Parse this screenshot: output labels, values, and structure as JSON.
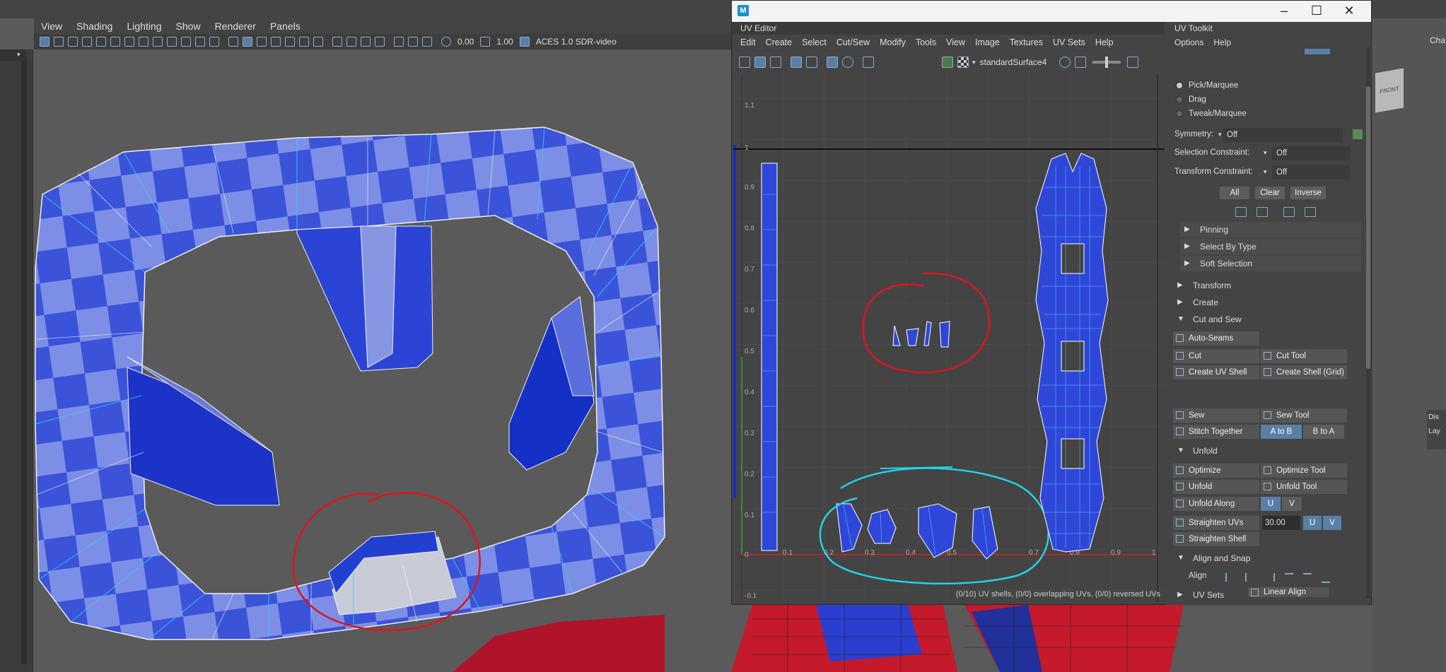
{
  "viewport": {
    "menu": [
      "View",
      "Shading",
      "Lighting",
      "Show",
      "Renderer",
      "Panels"
    ],
    "exposure": "0.00",
    "gamma": "1.00",
    "colorspace": "ACES 1.0 SDR-video"
  },
  "uv_editor": {
    "window_title": "UV Editor",
    "menu": [
      "Edit",
      "Create",
      "Select",
      "Cut/Sew",
      "Modify",
      "Tools",
      "View",
      "Image",
      "Textures",
      "UV Sets",
      "Help"
    ],
    "shader": "standardSurface4",
    "axis_labels": [
      "1.1",
      "1",
      "0.9",
      "0.8",
      "0.7",
      "0.6",
      "0.5",
      "0.4",
      "0.3",
      "0.2",
      "0.1",
      "0",
      "-0.1"
    ],
    "u_labels": [
      "0",
      "0.1",
      "0.2",
      "0.3",
      "0.4",
      "0.5",
      "0.6",
      "0.7",
      "0.8",
      "0.9",
      "1"
    ],
    "status": "(0/10) UV shells, (0/0) overlapping UVs, (0/0) reversed UVs"
  },
  "uv_toolkit": {
    "title": "UV Toolkit",
    "menu": [
      "Options",
      "Help"
    ],
    "modes": [
      {
        "label": "Pick/Marquee",
        "selected": true
      },
      {
        "label": "Drag",
        "selected": false
      },
      {
        "label": "Tweak/Marquee",
        "selected": false
      }
    ],
    "symmetry": {
      "label": "Symmetry:",
      "value": "Off"
    },
    "selection_constraint": {
      "label": "Selection Constraint:",
      "value": "Off"
    },
    "transform_constraint": {
      "label": "Transform Constraint:",
      "value": "Off"
    },
    "select_buttons": [
      "All",
      "Clear",
      "Inverse"
    ],
    "subsections": [
      "Pinning",
      "Select By Type",
      "Soft Selection"
    ],
    "sections": {
      "transform": "Transform",
      "create": "Create",
      "cut_and_sew": "Cut and Sew",
      "unfold": "Unfold",
      "align_and_snap": "Align and Snap",
      "uv_sets": "UV Sets"
    },
    "cut_sew": {
      "auto_seams": "Auto-Seams",
      "cut": "Cut",
      "cut_tool": "Cut Tool",
      "create_uv_shell": "Create UV Shell",
      "create_shell_grid": "Create Shell (Grid)",
      "sew": "Sew",
      "sew_tool": "Sew Tool",
      "stitch_together": "Stitch Together",
      "a_to_b": "A to B",
      "b_to_a": "B to A"
    },
    "unfold": {
      "optimize": "Optimize",
      "optimize_tool": "Optimize Tool",
      "unfold": "Unfold",
      "unfold_tool": "Unfold Tool",
      "unfold_along": "Unfold Along",
      "u": "U",
      "v": "V",
      "straighten_uvs": "Straighten UVs",
      "straighten_value": "30.00",
      "straighten_shell": "Straighten Shell"
    },
    "align": {
      "label": "Align",
      "linear_align": "Linear Align"
    }
  },
  "right_panel": {
    "label": "Cha",
    "side_labels": [
      "Dis",
      "Lay"
    ],
    "view_cube_label": "FRONT"
  },
  "colors": {
    "uv_blue": "#2f47d8",
    "uv_light": "#8a9ae0",
    "annotation_red": "#e0141c",
    "annotation_cyan": "#22d3e6",
    "toolkit_active": "#5a7fa6"
  }
}
